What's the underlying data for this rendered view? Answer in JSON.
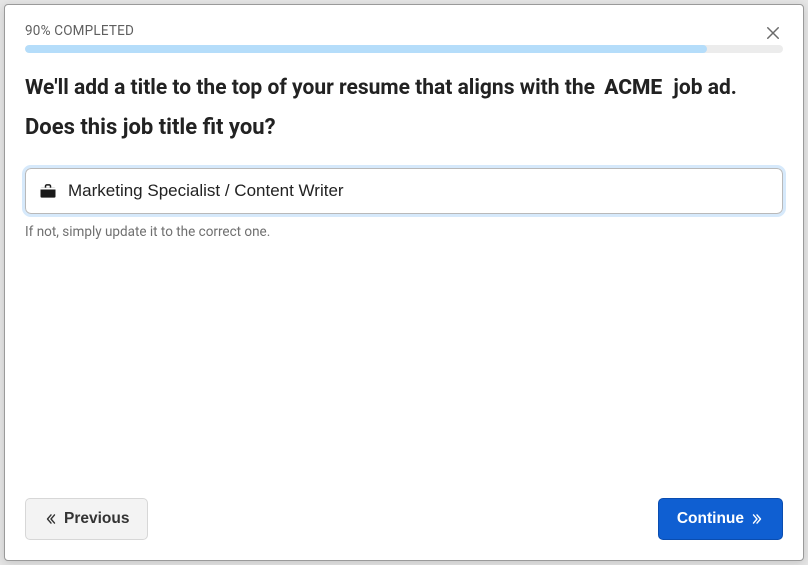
{
  "progress": {
    "label": "90% COMPLETED",
    "percent": 90
  },
  "heading": {
    "prefix": "We'll add a title to the top of your resume that aligns with the ",
    "company": "ACME",
    "suffix": " job ad."
  },
  "subheading": "Does this job title fit you?",
  "job_title_input": {
    "value": "Marketing Specialist / Content Writer",
    "placeholder": ""
  },
  "helper_text": "If not, simply update it to the correct one.",
  "buttons": {
    "previous": "Previous",
    "continue": "Continue"
  }
}
